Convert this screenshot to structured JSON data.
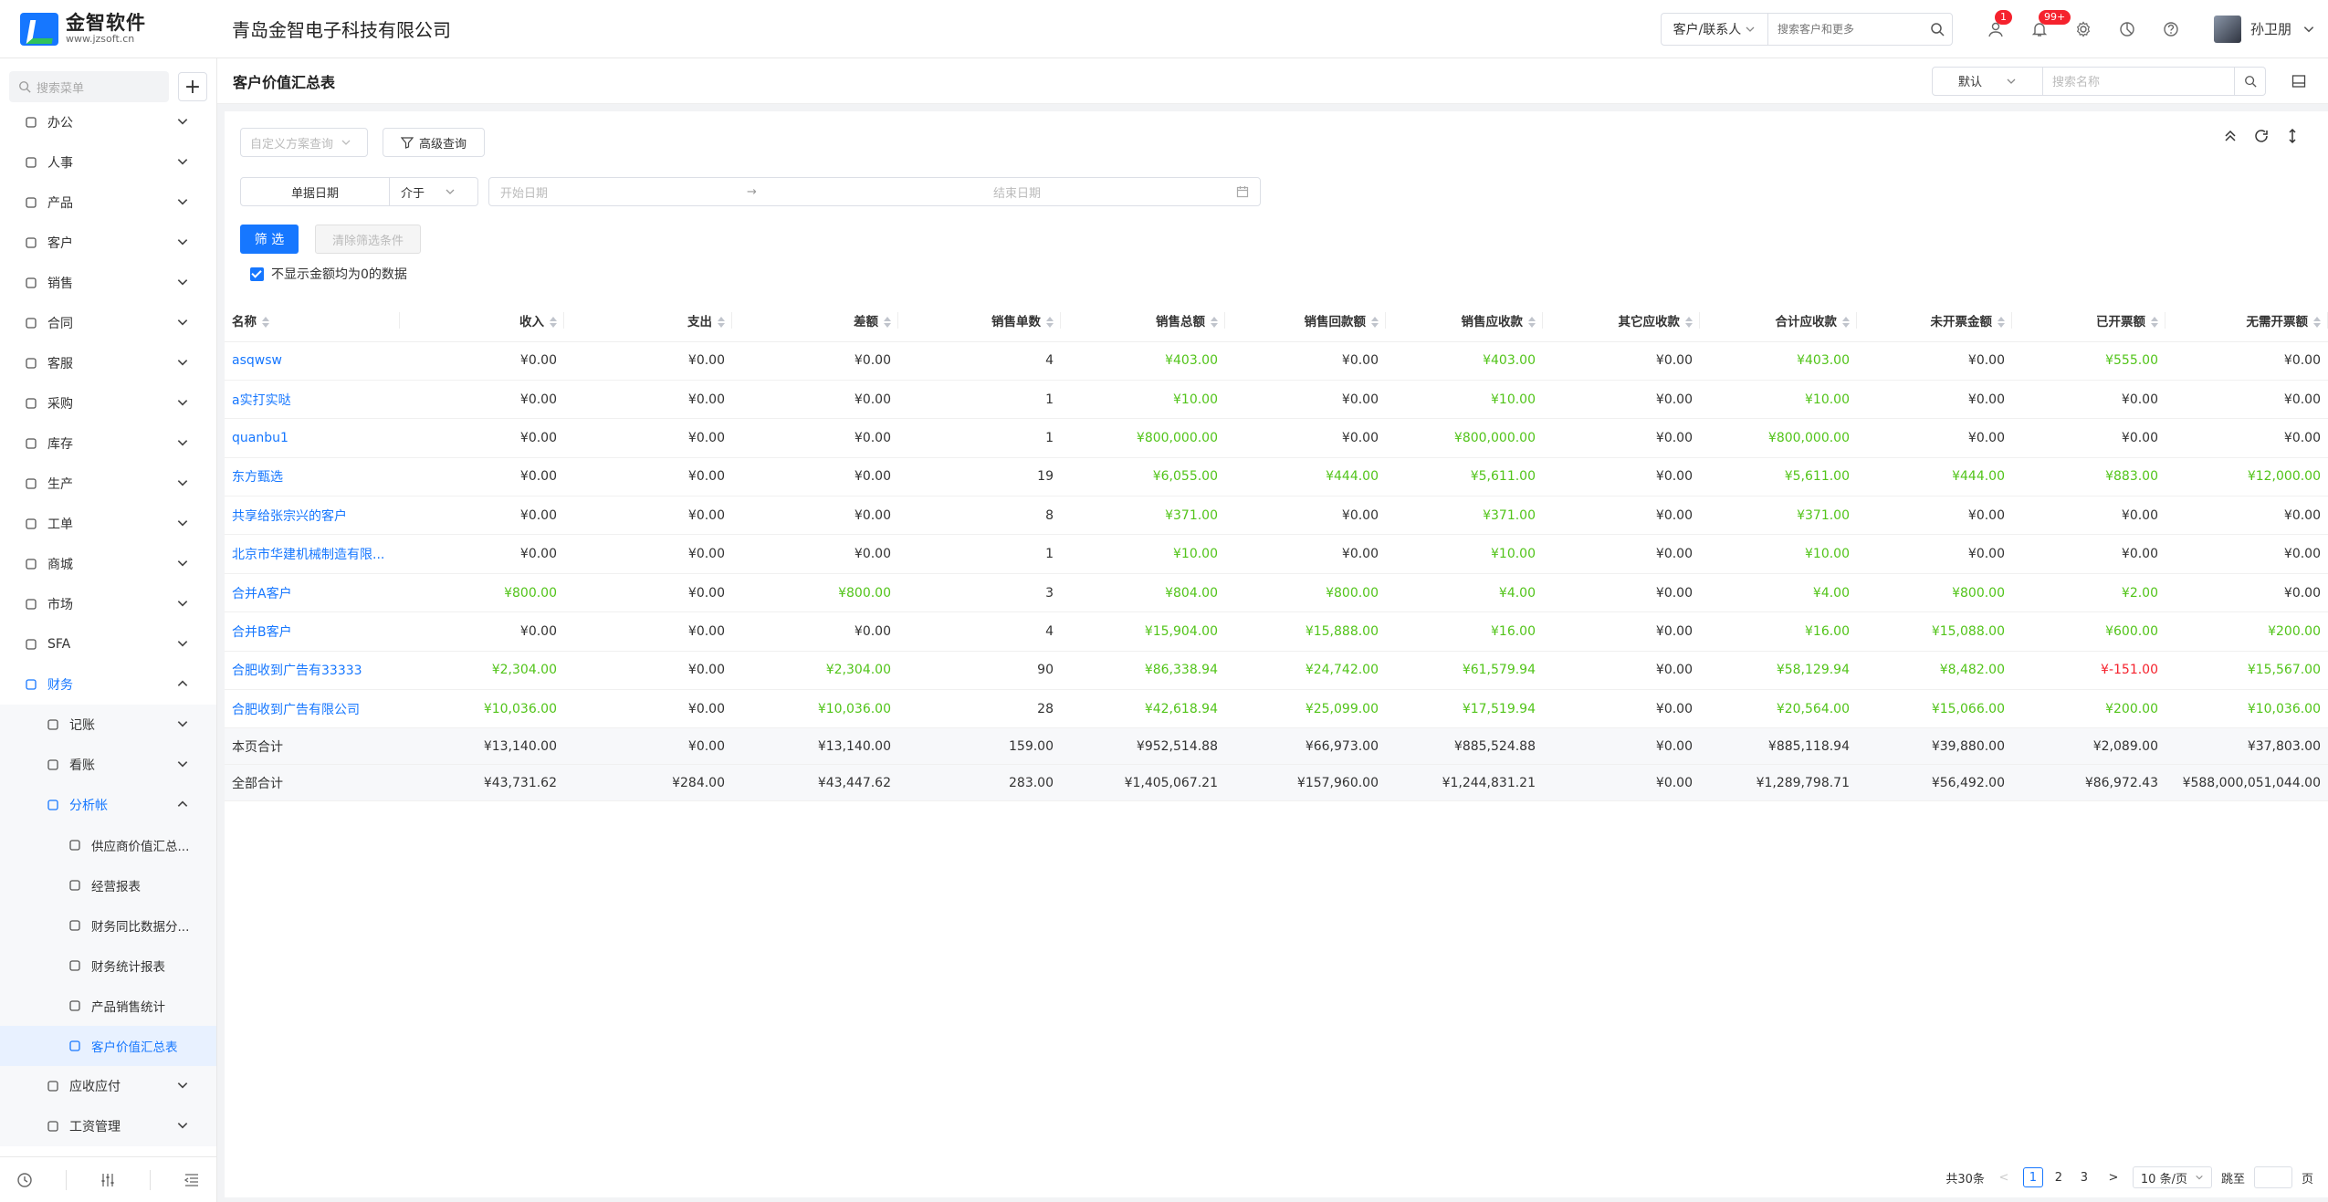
{
  "app": {
    "logo_text": "金智软件",
    "logo_url": "www.jzsoft.cn",
    "company": "青岛金智电子科技有限公司"
  },
  "header": {
    "search_type": "客户/联系人",
    "search_placeholder": "搜索客户和更多",
    "badge_tasks": "1",
    "badge_notify": "99+",
    "user_name": "孙卫朋"
  },
  "sidebar": {
    "search_placeholder": "搜索菜单",
    "items": [
      {
        "label": "办公",
        "icon": "office-icon"
      },
      {
        "label": "人事",
        "icon": "person-icon"
      },
      {
        "label": "产品",
        "icon": "cube-icon"
      },
      {
        "label": "客户",
        "icon": "customer-icon"
      },
      {
        "label": "销售",
        "icon": "sales-icon"
      },
      {
        "label": "合同",
        "icon": "contract-icon"
      },
      {
        "label": "客服",
        "icon": "headset-icon"
      },
      {
        "label": "采购",
        "icon": "purchase-icon"
      },
      {
        "label": "库存",
        "icon": "warehouse-icon"
      },
      {
        "label": "生产",
        "icon": "production-icon"
      },
      {
        "label": "工单",
        "icon": "ticket-icon"
      },
      {
        "label": "商城",
        "icon": "shop-icon"
      },
      {
        "label": "市场",
        "icon": "market-icon"
      },
      {
        "label": "SFA",
        "icon": "sfa-icon"
      },
      {
        "label": "财务",
        "icon": "finance-icon"
      }
    ],
    "finance_sub": [
      {
        "label": "记账"
      },
      {
        "label": "看账"
      },
      {
        "label": "分析帐"
      }
    ],
    "analysis_sub": [
      {
        "label": "供应商价值汇总..."
      },
      {
        "label": "经营报表"
      },
      {
        "label": "财务同比数据分..."
      },
      {
        "label": "财务统计报表"
      },
      {
        "label": "产品销售统计"
      },
      {
        "label": "客户价值汇总表"
      }
    ],
    "finance_sub2": [
      {
        "label": "应收应付"
      },
      {
        "label": "工资管理"
      }
    ]
  },
  "page": {
    "title": "客户价值汇总表",
    "view_select": "默认",
    "name_search_placeholder": "搜索名称"
  },
  "filters": {
    "scheme_placeholder": "自定义方案查询",
    "advanced": "高级查询",
    "date_field": "单据日期",
    "operator": "介于",
    "start_placeholder": "开始日期",
    "end_placeholder": "结束日期",
    "arrow": "→",
    "filter_btn": "筛 选",
    "clear_btn": "清除筛选条件",
    "hide_zero": "不显示金额均为0的数据"
  },
  "table": {
    "columns": [
      "名称",
      "收入",
      "支出",
      "差额",
      "销售单数",
      "销售总额",
      "销售回款额",
      "销售应收款",
      "其它应收款",
      "合计应收款",
      "未开票金额",
      "已开票额",
      "无需开票额"
    ],
    "rows": [
      [
        "asqwsw",
        "¥0.00",
        "¥0.00",
        "¥0.00",
        "4",
        "¥403.00",
        "¥0.00",
        "¥403.00",
        "¥0.00",
        "¥403.00",
        "¥0.00",
        "¥555.00",
        "¥0.00"
      ],
      [
        "a实打实哒",
        "¥0.00",
        "¥0.00",
        "¥0.00",
        "1",
        "¥10.00",
        "¥0.00",
        "¥10.00",
        "¥0.00",
        "¥10.00",
        "¥0.00",
        "¥0.00",
        "¥0.00"
      ],
      [
        "quanbu1",
        "¥0.00",
        "¥0.00",
        "¥0.00",
        "1",
        "¥800,000.00",
        "¥0.00",
        "¥800,000.00",
        "¥0.00",
        "¥800,000.00",
        "¥0.00",
        "¥0.00",
        "¥0.00"
      ],
      [
        "东方甄选",
        "¥0.00",
        "¥0.00",
        "¥0.00",
        "19",
        "¥6,055.00",
        "¥444.00",
        "¥5,611.00",
        "¥0.00",
        "¥5,611.00",
        "¥444.00",
        "¥883.00",
        "¥12,000.00"
      ],
      [
        "共享给张宗兴的客户",
        "¥0.00",
        "¥0.00",
        "¥0.00",
        "8",
        "¥371.00",
        "¥0.00",
        "¥371.00",
        "¥0.00",
        "¥371.00",
        "¥0.00",
        "¥0.00",
        "¥0.00"
      ],
      [
        "北京市华建机械制造有限...",
        "¥0.00",
        "¥0.00",
        "¥0.00",
        "1",
        "¥10.00",
        "¥0.00",
        "¥10.00",
        "¥0.00",
        "¥10.00",
        "¥0.00",
        "¥0.00",
        "¥0.00"
      ],
      [
        "合并A客户",
        "¥800.00",
        "¥0.00",
        "¥800.00",
        "3",
        "¥804.00",
        "¥800.00",
        "¥4.00",
        "¥0.00",
        "¥4.00",
        "¥800.00",
        "¥2.00",
        "¥0.00"
      ],
      [
        "合并B客户",
        "¥0.00",
        "¥0.00",
        "¥0.00",
        "4",
        "¥15,904.00",
        "¥15,888.00",
        "¥16.00",
        "¥0.00",
        "¥16.00",
        "¥15,088.00",
        "¥600.00",
        "¥200.00"
      ],
      [
        "合肥收到广告有33333",
        "¥2,304.00",
        "¥0.00",
        "¥2,304.00",
        "90",
        "¥86,338.94",
        "¥24,742.00",
        "¥61,579.94",
        "¥0.00",
        "¥58,129.94",
        "¥8,482.00",
        "¥-151.00",
        "¥15,567.00"
      ],
      [
        "合肥收到广告有限公司",
        "¥10,036.00",
        "¥0.00",
        "¥10,036.00",
        "28",
        "¥42,618.94",
        "¥25,099.00",
        "¥17,519.94",
        "¥0.00",
        "¥20,564.00",
        "¥15,066.00",
        "¥200.00",
        "¥10,036.00"
      ]
    ],
    "page_total": [
      "本页合计",
      "¥13,140.00",
      "¥0.00",
      "¥13,140.00",
      "159.00",
      "¥952,514.88",
      "¥66,973.00",
      "¥885,524.88",
      "¥0.00",
      "¥885,118.94",
      "¥39,880.00",
      "¥2,089.00",
      "¥37,803.00"
    ],
    "grand_total": [
      "全部合计",
      "¥43,731.62",
      "¥284.00",
      "¥43,447.62",
      "283.00",
      "¥1,405,067.21",
      "¥157,960.00",
      "¥1,244,831.21",
      "¥0.00",
      "¥1,289,798.71",
      "¥56,492.00",
      "¥86,972.43",
      "¥588,000,051,044.00"
    ]
  },
  "colors": {
    "primary": "#1677ff",
    "positive": "#52c41a",
    "negative": "#f5222d"
  },
  "pager": {
    "total": "共30条",
    "pages": [
      "1",
      "2",
      "3"
    ],
    "current": "1",
    "size": "10 条/页",
    "jump_label": "跳至",
    "page_suffix": "页"
  }
}
